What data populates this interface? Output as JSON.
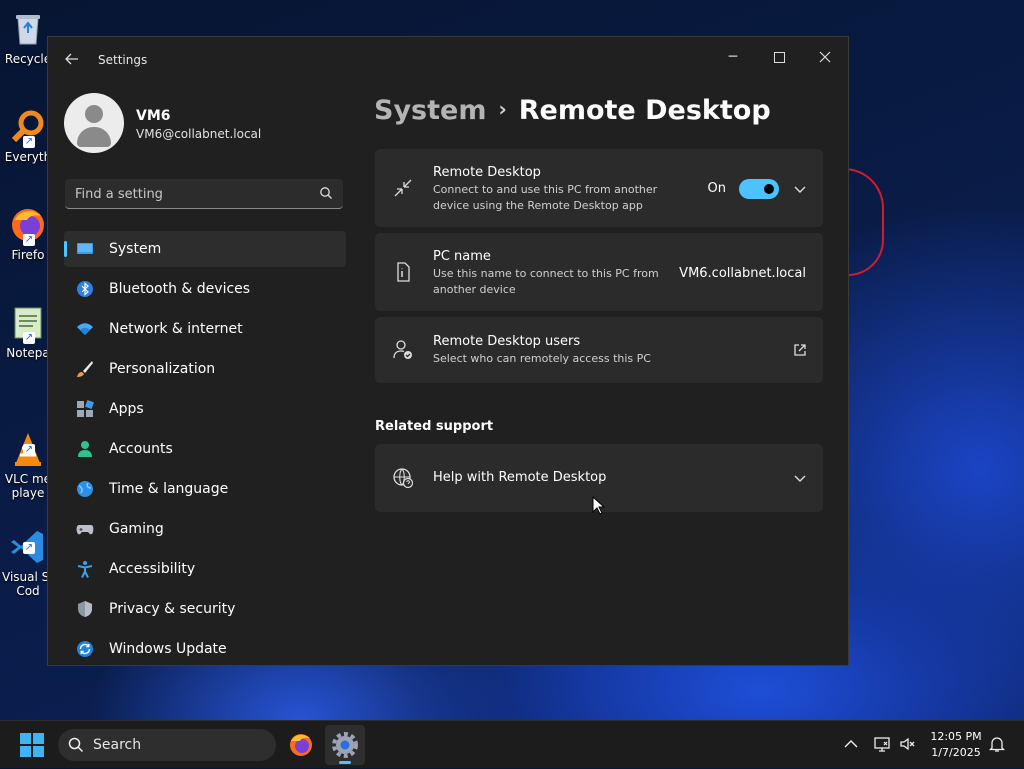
{
  "desktop": {
    "icons": [
      {
        "label": "Recycle",
        "icon": "recycle-bin-icon"
      },
      {
        "label": "Everyth",
        "icon": "everything-search-icon"
      },
      {
        "label": "Firefo",
        "icon": "firefox-icon"
      },
      {
        "label": "Notepa",
        "icon": "notepad-icon"
      },
      {
        "label": "VLC me\nplaye",
        "icon": "vlc-icon"
      },
      {
        "label": "Visual St\nCod",
        "icon": "vscode-icon"
      }
    ]
  },
  "window": {
    "title": "Settings",
    "controls": {
      "minimize": "minimize-icon",
      "maximize": "maximize-icon",
      "close": "close-icon"
    }
  },
  "profile": {
    "name": "VM6",
    "email": "VM6@collabnet.local"
  },
  "search": {
    "placeholder": "Find a setting"
  },
  "nav": {
    "items": [
      {
        "label": "System",
        "icon": "system-icon",
        "selected": true
      },
      {
        "label": "Bluetooth & devices",
        "icon": "bluetooth-icon"
      },
      {
        "label": "Network & internet",
        "icon": "wifi-icon"
      },
      {
        "label": "Personalization",
        "icon": "brush-icon"
      },
      {
        "label": "Apps",
        "icon": "apps-icon"
      },
      {
        "label": "Accounts",
        "icon": "accounts-icon"
      },
      {
        "label": "Time & language",
        "icon": "globe-clock-icon"
      },
      {
        "label": "Gaming",
        "icon": "gamepad-icon"
      },
      {
        "label": "Accessibility",
        "icon": "accessibility-icon"
      },
      {
        "label": "Privacy & security",
        "icon": "shield-icon"
      },
      {
        "label": "Windows Update",
        "icon": "update-icon"
      }
    ]
  },
  "breadcrumb": {
    "parent": "System",
    "separator": "›",
    "current": "Remote Desktop"
  },
  "cards": {
    "remote_desktop": {
      "title": "Remote Desktop",
      "desc": "Connect to and use this PC from another device using the Remote Desktop app",
      "state_label": "On",
      "enabled": true
    },
    "pc_name": {
      "title": "PC name",
      "desc": "Use this name to connect to this PC from another device",
      "value": "VM6.collabnet.local"
    },
    "rd_users": {
      "title": "Remote Desktop users",
      "desc": "Select who can remotely access this PC"
    }
  },
  "related": {
    "label": "Related support",
    "help_title": "Help with Remote Desktop"
  },
  "taskbar": {
    "search_label": "Search",
    "time": "12:05 PM",
    "date": "1/7/2025"
  },
  "colors": {
    "accent": "#4cc2ff",
    "window_bg": "#202020",
    "card_bg": "#2b2b2b"
  }
}
